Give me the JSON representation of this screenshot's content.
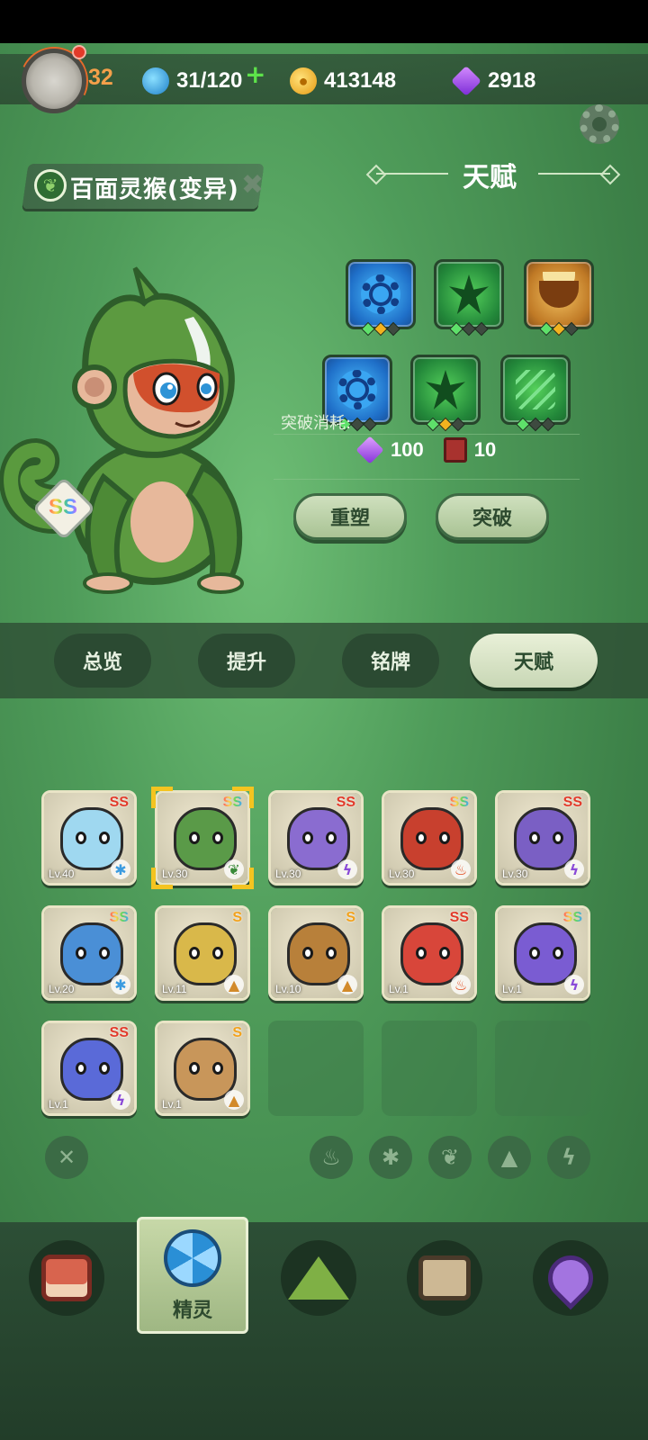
{
  "header": {
    "player_level": "32",
    "stamina": "31/120",
    "stamina_plus": "+",
    "coins": "413148",
    "gems": "2918"
  },
  "pet": {
    "name": "百面灵猴(变异)",
    "rank": "SS"
  },
  "talent": {
    "title": "天赋",
    "skills": [
      {
        "icon": "blue-gear-icon",
        "pips": [
          "g",
          "o",
          "d"
        ]
      },
      {
        "icon": "green-star-icon",
        "pips": [
          "g",
          "d",
          "d"
        ]
      },
      {
        "icon": "gold-bowl-icon",
        "pips": [
          "g",
          "o",
          "d"
        ]
      },
      {
        "icon": "blue-gear-icon",
        "pips": [
          "g",
          "d",
          "d"
        ]
      },
      {
        "icon": "green-star-icon",
        "pips": [
          "g",
          "o",
          "d"
        ]
      },
      {
        "icon": "green-claw-icon",
        "pips": [
          "g",
          "d",
          "d"
        ]
      }
    ],
    "cost_label": "突破消耗:",
    "cost_gems": "100",
    "cost_books": "10",
    "reshape_button": "重塑",
    "breakthrough_button": "突破"
  },
  "tabs": [
    "总览",
    "提升",
    "铭牌",
    "天赋"
  ],
  "active_tab": "天赋",
  "roster": [
    {
      "level": "Lv.40",
      "rank": "SS",
      "element": "ice",
      "color": "#9fd8f0"
    },
    {
      "level": "Lv.30",
      "rank": "SS",
      "element": "grass",
      "color": "#5a9a48",
      "selected": true
    },
    {
      "level": "Lv.30",
      "rank": "SS",
      "element": "thunder",
      "color": "#8a6cd0"
    },
    {
      "level": "Lv.30",
      "rank": "SS",
      "element": "fire",
      "color": "#c8402e"
    },
    {
      "level": "Lv.30",
      "rank": "SS",
      "element": "thunder",
      "color": "#7a5fc4"
    },
    {
      "level": "Lv.20",
      "rank": "SS",
      "element": "ice",
      "color": "#4a8fd6"
    },
    {
      "level": "Lv.11",
      "rank": "S",
      "element": "earth",
      "color": "#d9b84a"
    },
    {
      "level": "Lv.10",
      "rank": "S",
      "element": "earth",
      "color": "#b8803a"
    },
    {
      "level": "Lv.1",
      "rank": "SS",
      "element": "fire",
      "color": "#d8463a"
    },
    {
      "level": "Lv.1",
      "rank": "SS",
      "element": "thunder",
      "color": "#7a5cd2"
    },
    {
      "level": "Lv.1",
      "rank": "SS",
      "element": "thunder",
      "color": "#5a6ad8"
    },
    {
      "level": "Lv.1",
      "rank": "S",
      "element": "earth",
      "color": "#c8965a"
    }
  ],
  "filters": [
    "clear",
    "fire",
    "ice",
    "grass",
    "earth",
    "thunder"
  ],
  "bottom_nav": {
    "active_label": "精灵",
    "items": [
      "terminal-icon",
      "spirit-icon",
      "mountain-icon",
      "chest-icon",
      "map-pin-icon"
    ]
  },
  "colors": {
    "accent_green": "#4f9c5a",
    "gem_purple": "#8432d8",
    "level_orange": "#f4a04a"
  }
}
